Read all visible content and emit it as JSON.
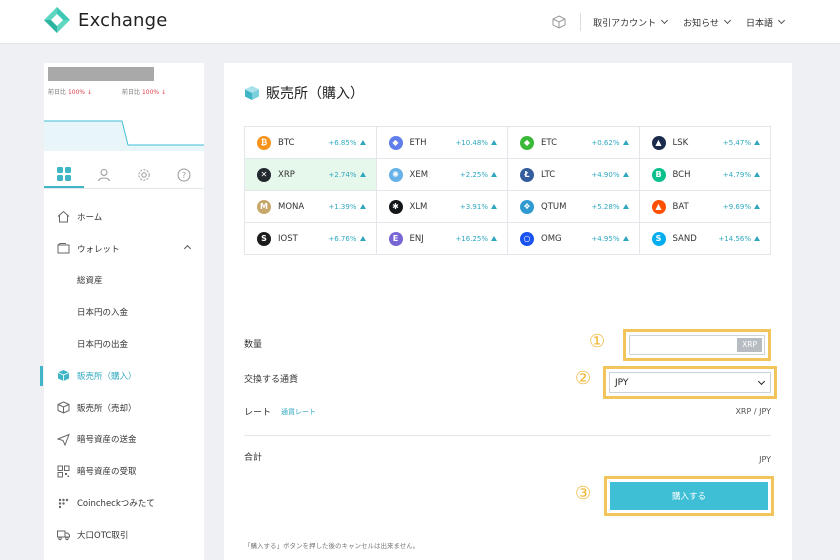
{
  "header": {
    "app_name": "Exchange",
    "nav": [
      "取引アカウント",
      "お知らせ",
      "日本語"
    ]
  },
  "sidebar": {
    "ratios": [
      {
        "label": "前日比",
        "value": "100% ↓"
      },
      {
        "label": "前日比",
        "value": "100% ↓"
      }
    ],
    "tabs": [
      "grid-icon",
      "user-icon",
      "gear-icon",
      "help-icon"
    ],
    "menu": [
      {
        "label": "ホーム",
        "icon": "home-icon"
      },
      {
        "label": "ウォレット",
        "icon": "wallet-icon"
      },
      {
        "label": "総資産",
        "sub": true
      },
      {
        "label": "日本円の入金",
        "sub": true
      },
      {
        "label": "日本円の出金",
        "sub": true
      },
      {
        "label": "販売所（購入）",
        "icon": "cube-icon",
        "active": true
      },
      {
        "label": "販売所（売却）",
        "icon": "cube-outline-icon"
      },
      {
        "label": "暗号資産の送金",
        "icon": "send-icon"
      },
      {
        "label": "暗号資産の受取",
        "icon": "qr-icon"
      },
      {
        "label": "Coincheckつみたて",
        "icon": "dots-icon"
      },
      {
        "label": "大口OTC取引",
        "icon": "truck-icon"
      }
    ]
  },
  "main": {
    "title": "販売所（購入）",
    "coins": [
      {
        "name": "BTC",
        "change": "+6.85%",
        "color": "#f7931a",
        "glyph": "₿"
      },
      {
        "name": "ETH",
        "change": "+10.48%",
        "color": "#627eea",
        "glyph": "◆"
      },
      {
        "name": "ETC",
        "change": "+0.62%",
        "color": "#3ab83a",
        "glyph": "◆"
      },
      {
        "name": "LSK",
        "change": "+5.47%",
        "color": "#1a2b4c",
        "glyph": "▲"
      },
      {
        "name": "XRP",
        "change": "+2.74%",
        "color": "#23292f",
        "glyph": "✕",
        "selected": true
      },
      {
        "name": "XEM",
        "change": "+2.25%",
        "color": "#67b2e8",
        "glyph": "✺"
      },
      {
        "name": "LTC",
        "change": "+4.90%",
        "color": "#345d9d",
        "glyph": "Ł"
      },
      {
        "name": "BCH",
        "change": "+4.79%",
        "color": "#0ac18e",
        "glyph": "B"
      },
      {
        "name": "MONA",
        "change": "+1.39%",
        "color": "#c8a76a",
        "glyph": "M"
      },
      {
        "name": "XLM",
        "change": "+3.91%",
        "color": "#14171a",
        "glyph": "✱"
      },
      {
        "name": "QTUM",
        "change": "+5.28%",
        "color": "#2e9ad0",
        "glyph": "❖"
      },
      {
        "name": "BAT",
        "change": "+9.69%",
        "color": "#ff5000",
        "glyph": "▲"
      },
      {
        "name": "IOST",
        "change": "+6.76%",
        "color": "#1c1c1c",
        "glyph": "S"
      },
      {
        "name": "ENJ",
        "change": "+16.25%",
        "color": "#7866d5",
        "glyph": "E"
      },
      {
        "name": "OMG",
        "change": "+4.95%",
        "color": "#1a53f0",
        "glyph": "○"
      },
      {
        "name": "SAND",
        "change": "+14.56%",
        "color": "#04adef",
        "glyph": "S"
      }
    ],
    "quantity_label": "数量",
    "quantity_value": "",
    "quantity_unit": "XRP",
    "currency_label": "交換する通貨",
    "currency_value": "JPY",
    "rate_label": "レート",
    "rate_link": "通貨レート",
    "rate_value": "XRP / JPY",
    "total_label": "合計",
    "total_value": "JPY",
    "buy_button": "購入する",
    "note": "「購入する」ボタンを押した後のキャンセルは出来ません。",
    "markers": [
      "①",
      "②",
      "③"
    ]
  },
  "colors": {
    "accent": "#3fbfd6",
    "highlight": "#f2c55c",
    "logo": "#3cc8b4"
  }
}
